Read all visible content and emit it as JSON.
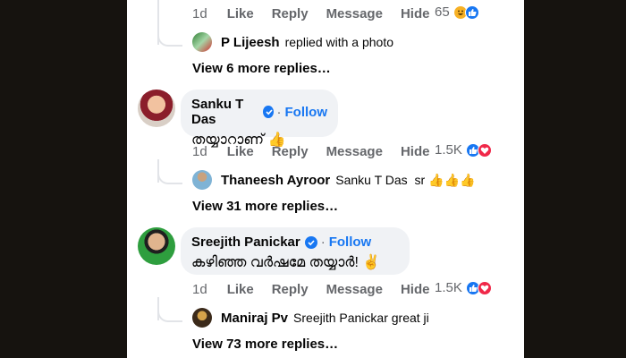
{
  "top_actions": {
    "time": "1d",
    "like": "Like",
    "reply": "Reply",
    "message": "Message",
    "hide": "Hide",
    "count": "65"
  },
  "top_reply": {
    "name": "P Lijeesh",
    "text": "replied with a photo"
  },
  "top_more": "View 6 more replies…",
  "comments": [
    {
      "author": "Sanku T Das",
      "follow": "Follow",
      "text": "തയ്യാറാണ്",
      "emoji": "👍",
      "actions": {
        "time": "1d",
        "like": "Like",
        "reply": "Reply",
        "message": "Message",
        "hide": "Hide",
        "count": "1.5K"
      },
      "reply": {
        "name": "Thaneesh Ayroor",
        "text": "Sanku T Das  sr",
        "emoji": "👍👍👍"
      },
      "more": "View 31 more replies…"
    },
    {
      "author": "Sreejith Panickar",
      "follow": "Follow",
      "text": "കഴിഞ്ഞ വർഷമേ തയ്യാർ!",
      "emoji": "✌️",
      "actions": {
        "time": "1d",
        "like": "Like",
        "reply": "Reply",
        "message": "Message",
        "hide": "Hide",
        "count": "1.5K"
      },
      "reply": {
        "name": "Maniraj Pv",
        "text": "Sreejith Panickar great ji"
      },
      "more": "View 73 more replies…"
    }
  ],
  "colors": {
    "accent": "#1877f2",
    "love": "#f02849",
    "haha": "#f7b125",
    "bubble": "#f0f2f5"
  }
}
